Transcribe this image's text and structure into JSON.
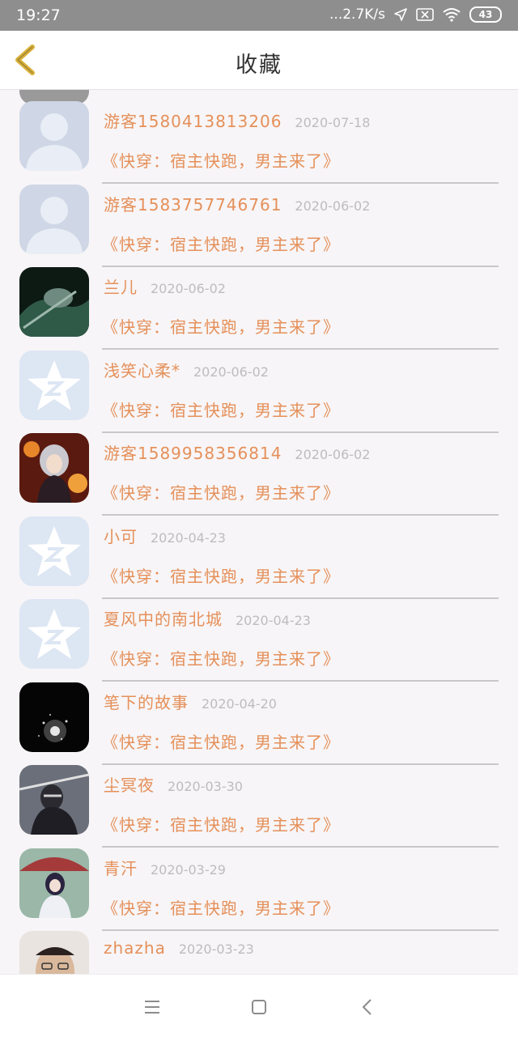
{
  "status_bar": {
    "time": "19:27",
    "network_speed": "...2.7K/s",
    "battery": "43"
  },
  "header": {
    "title": "收藏"
  },
  "favorites": [
    {
      "name": "游客1580413813206",
      "date": "2020-07-18",
      "book": "《快穿：宿主快跑，男主来了》",
      "avatar_icon": "default-user-avatar-icon"
    },
    {
      "name": "游客1583757746761",
      "date": "2020-06-02",
      "book": "《快穿：宿主快跑，男主来了》",
      "avatar_icon": "default-user-avatar-icon"
    },
    {
      "name": "兰儿",
      "date": "2020-06-02",
      "book": "《快穿：宿主快跑，男主来了》",
      "avatar_icon": "dark-photo-avatar"
    },
    {
      "name": "浅笑心柔*",
      "date": "2020-06-02",
      "book": "《快穿：宿主快跑，男主来了》",
      "avatar_icon": "qzone-star-avatar-icon"
    },
    {
      "name": "游客1589958356814",
      "date": "2020-06-02",
      "book": "《快穿：宿主快跑，男主来了》",
      "avatar_icon": "anime-girl-avatar"
    },
    {
      "name": "小可",
      "date": "2020-04-23",
      "book": "《快穿：宿主快跑，男主来了》",
      "avatar_icon": "qzone-star-avatar-icon"
    },
    {
      "name": "夏风中的南北城",
      "date": "2020-04-23",
      "book": "《快穿：宿主快跑，男主来了》",
      "avatar_icon": "qzone-star-avatar-icon"
    },
    {
      "name": "笔下的故事",
      "date": "2020-04-20",
      "book": "《快穿：宿主快跑，男主来了》",
      "avatar_icon": "sparkle-night-avatar"
    },
    {
      "name": "尘冥夜",
      "date": "2020-03-30",
      "book": "《快穿：宿主快跑，男主来了》",
      "avatar_icon": "ninja-avatar"
    },
    {
      "name": "青汗",
      "date": "2020-03-29",
      "book": "《快穿：宿主快跑，男主来了》",
      "avatar_icon": "umbrella-girl-avatar"
    },
    {
      "name": "zhazha",
      "date": "2020-03-23",
      "book": "",
      "avatar_icon": "man-photo-avatar"
    }
  ],
  "colors": {
    "accent": "#e5905a",
    "date": "#bdbdbd",
    "back_arrow": "#d9b13a"
  }
}
